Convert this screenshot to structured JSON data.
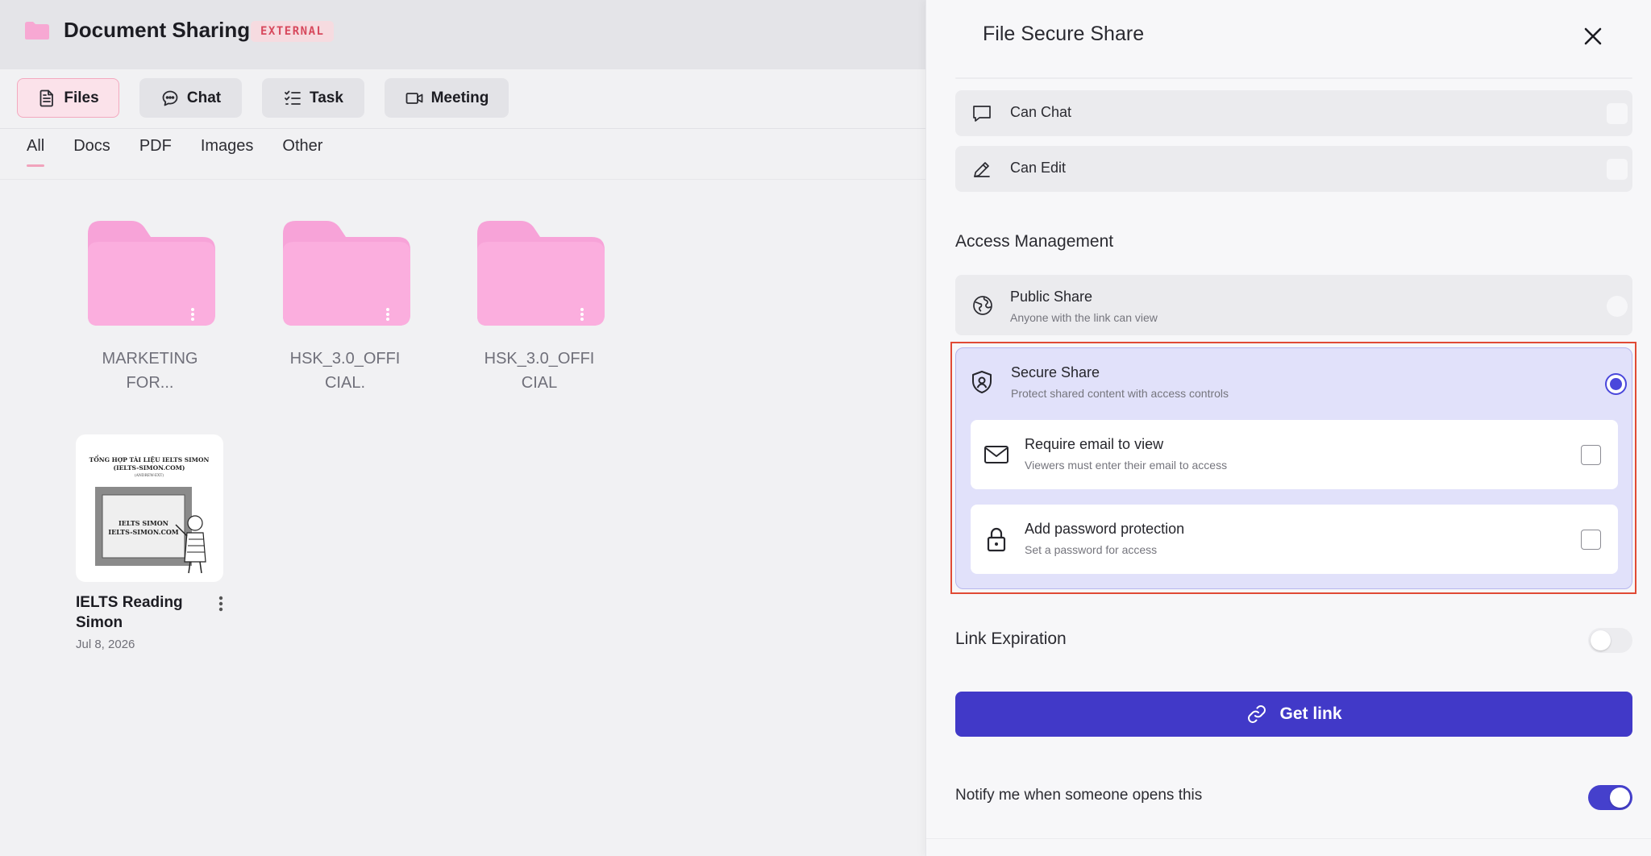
{
  "app": {
    "title": "Document Sharing",
    "badge": "EXTERNAL",
    "folder_icon": "folder-icon",
    "accent_color": "#f7a8d3"
  },
  "mode_tabs": [
    {
      "label": "Files",
      "icon": "document-icon",
      "active": true
    },
    {
      "label": "Chat",
      "icon": "chat-bubble-icon",
      "active": false
    },
    {
      "label": "Task",
      "icon": "checklist-icon",
      "active": false
    },
    {
      "label": "Meeting",
      "icon": "video-camera-icon",
      "active": false
    }
  ],
  "filter_tabs": [
    {
      "label": "All",
      "active": true
    },
    {
      "label": "Docs",
      "active": false
    },
    {
      "label": "PDF",
      "active": false
    },
    {
      "label": "Images",
      "active": false
    },
    {
      "label": "Other",
      "active": false
    }
  ],
  "folders": [
    {
      "name_line1": "MARKETING",
      "name_line2": "FOR..."
    },
    {
      "name_line1": "HSK_3.0_OFFI",
      "name_line2": "CIAL."
    },
    {
      "name_line1": "HSK_3.0_OFFI",
      "name_line2": "CIAL"
    }
  ],
  "document": {
    "name": "IELTS Reading Simon",
    "date": "Jul 8, 2026",
    "thumb_line1": "TỔNG HỢP TÀI LIỆU IELTS SIMON",
    "thumb_line2": "(IELTS-SIMON.COM)",
    "thumb_line3": "(ANDREW-EXT)",
    "thumb_board1": "IELTS SIMON",
    "thumb_board2": "IELTS-SIMON.COM"
  },
  "panel": {
    "title": "File Secure Share",
    "permissions": [
      {
        "label": "Can Chat",
        "icon": "chat-bubble-icon",
        "checked": false
      },
      {
        "label": "Can Edit",
        "icon": "pencil-icon",
        "checked": false
      }
    ],
    "access_title": "Access Management",
    "public_share": {
      "label": "Public Share",
      "sub": "Anyone with the link can view",
      "icon": "globe-icon",
      "selected": false
    },
    "secure_share": {
      "label": "Secure Share",
      "sub": "Protect shared content with access controls",
      "icon": "shield-icon",
      "selected": true,
      "options": [
        {
          "label": "Require email to view",
          "sub": "Viewers must enter their email to access",
          "icon": "mail-icon",
          "checked": false
        },
        {
          "label": "Add password protection",
          "sub": "Set a password for access",
          "icon": "lock-icon",
          "checked": false
        }
      ]
    },
    "link_expiration": {
      "label": "Link Expiration",
      "enabled": false
    },
    "get_link": {
      "label": "Get link",
      "icon": "link-icon",
      "color": "#4139c8"
    },
    "notify": {
      "label": "Notify me when someone opens this",
      "enabled": true
    },
    "highlight_color": "#e04a35"
  }
}
